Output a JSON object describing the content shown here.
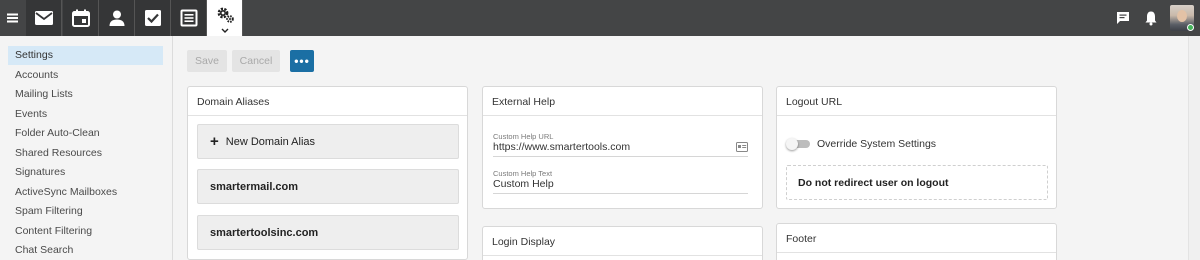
{
  "topbar": {
    "apps": [
      {
        "name": "mail-icon"
      },
      {
        "name": "calendar-icon"
      },
      {
        "name": "contacts-icon"
      },
      {
        "name": "tasks-icon"
      },
      {
        "name": "notes-icon"
      },
      {
        "name": "settings-gear-icon",
        "active": true
      }
    ],
    "right_icons": [
      "chat-icon",
      "bell-icon",
      "user-avatar"
    ],
    "status_color": "#44b35a"
  },
  "sidebar": {
    "items": [
      {
        "label": "Settings",
        "active": true
      },
      {
        "label": "Accounts"
      },
      {
        "label": "Mailing Lists"
      },
      {
        "label": "Events"
      },
      {
        "label": "Folder Auto-Clean"
      },
      {
        "label": "Shared Resources"
      },
      {
        "label": "Signatures"
      },
      {
        "label": "ActiveSync Mailboxes"
      },
      {
        "label": "Spam Filtering"
      },
      {
        "label": "Content Filtering"
      },
      {
        "label": "Chat Search"
      }
    ]
  },
  "toolbar": {
    "save_label": "Save",
    "cancel_label": "Cancel",
    "more_label": "•••",
    "accent_color": "#1b6fa4"
  },
  "domain_aliases": {
    "title": "Domain Aliases",
    "new_label": "New Domain Alias",
    "aliases": [
      "smartermail.com",
      "smartertoolsinc.com"
    ]
  },
  "external_help": {
    "title": "External Help",
    "url_label": "Custom Help URL",
    "url_value": "https://www.smartertools.com",
    "text_label": "Custom Help Text",
    "text_value": "Custom Help"
  },
  "login_display": {
    "title": "Login Display"
  },
  "logout_url": {
    "title": "Logout URL",
    "toggle_label": "Override System Settings",
    "toggle_on": false,
    "value": "Do not redirect user on logout"
  },
  "footer_card": {
    "title": "Footer"
  }
}
